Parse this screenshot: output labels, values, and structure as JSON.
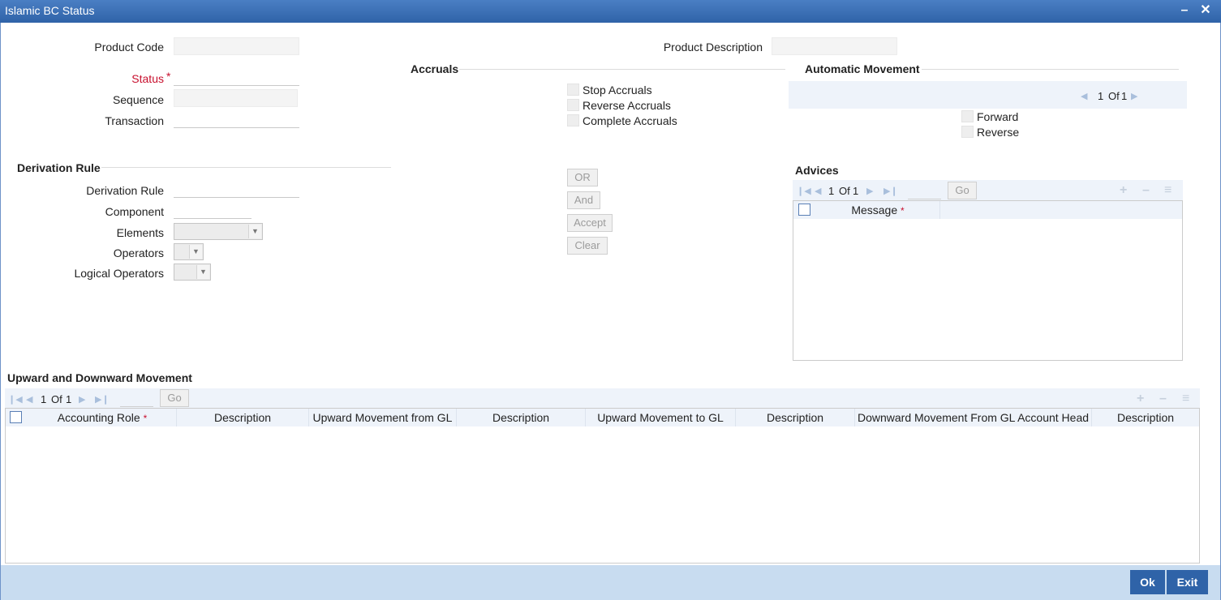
{
  "window": {
    "title": "Islamic BC Status",
    "minimize_icon": "minimize-icon",
    "close_icon": "close-icon"
  },
  "product": {
    "code_label": "Product Code",
    "code_value": "",
    "description_label": "Product Description",
    "description_value": "",
    "status_label": "Status",
    "status_required": "*",
    "status_value": "",
    "sequence_label": "Sequence",
    "sequence_value": "",
    "transaction_label": "Transaction",
    "transaction_value": ""
  },
  "accruals": {
    "title": "Accruals",
    "options": [
      "Stop Accruals",
      "Reverse Accruals",
      "Complete Accruals"
    ]
  },
  "automatic_movement": {
    "title": "Automatic Movement",
    "page_current": "1",
    "page_of": "Of",
    "page_total": "1",
    "options": [
      "Forward",
      "Reverse"
    ]
  },
  "derivation": {
    "title": "Derivation Rule",
    "rule_label": "Derivation Rule",
    "rule_value": "",
    "component_label": "Component",
    "component_value": "",
    "elements_label": "Elements",
    "elements_value": "",
    "operators_label": "Operators",
    "operators_value": "",
    "logical_operators_label": "Logical Operators",
    "logical_operators_value": ""
  },
  "rule_buttons": {
    "or": "OR",
    "and": "And",
    "accept": "Accept",
    "clear": "Clear"
  },
  "advices": {
    "title": "Advices",
    "page_current": "1",
    "page_of": "Of",
    "page_total": "1",
    "go": "Go",
    "column_message": "Message",
    "required": "*"
  },
  "movement": {
    "title": "Upward and Downward Movement",
    "page_current": "1",
    "page_of": "Of",
    "page_total": "1",
    "go": "Go",
    "required": "*",
    "columns": [
      "Accounting Role",
      "Description",
      "Upward Movement from GL",
      "Description",
      "Upward Movement to GL",
      "Description",
      "Downward Movement From GL Account Head",
      "Description"
    ]
  },
  "footer": {
    "ok": "Ok",
    "exit": "Exit"
  }
}
